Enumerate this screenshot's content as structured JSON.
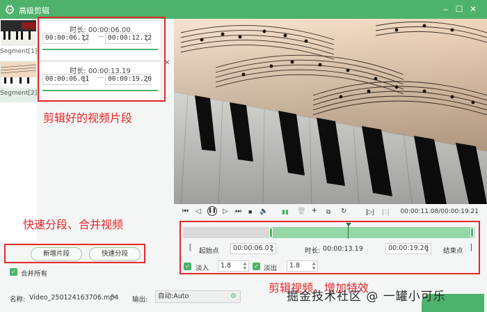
{
  "window": {
    "title": "高级剪辑",
    "min": "–",
    "max": "☐",
    "close": "✕"
  },
  "segments": [
    {
      "label": "Segment[1]",
      "duration_label": "时长:",
      "duration": "00:00:06.00",
      "start": "00:00:06.12",
      "end": "00:00:12.12"
    },
    {
      "label": "Segment[2]",
      "duration_label": "时长:",
      "duration": "00:00:13.19",
      "start": "00:00:06.01",
      "end": "00:00:19.20"
    }
  ],
  "annotations": {
    "segments": "剪辑好的视频片段",
    "split": "快速分段、合并视频",
    "edit": "剪辑视频，增加特效"
  },
  "buttons": {
    "new_segment": "新增片段",
    "quick_split": "快速分段",
    "merge_all": "合并所有"
  },
  "player": {
    "timecode": "00:00:11.08/00:00:19.21"
  },
  "trim": {
    "start_bracket": "[",
    "start_label": "起始点",
    "start_value": "00:00:06.01",
    "duration_label": "时长:",
    "duration_value": "00:00:13.19",
    "end_value": "00:00:19.20",
    "end_label": "结束点",
    "end_bracket": "]"
  },
  "effects": {
    "fade_in_label": "淡入",
    "fade_in_value": "1.8",
    "fade_out_label": "淡出",
    "fade_out_value": "1.8"
  },
  "output": {
    "name_label": "名称:",
    "name_value": "Video_250124163706.mp4",
    "output_label": "输出:",
    "output_value": "自动:Auto"
  },
  "watermark": "掘金技术社区 @ 一罐小可乐",
  "colors": {
    "accent": "#4db26b",
    "annotation": "#e5262a",
    "selection": "#95d7a7"
  }
}
